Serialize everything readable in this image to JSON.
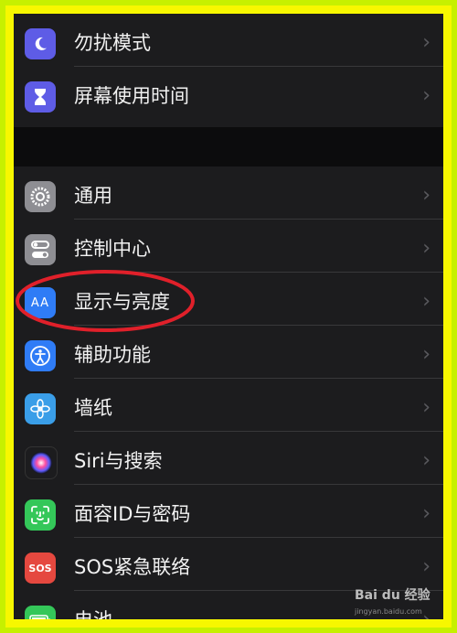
{
  "settings": {
    "top_group": [
      {
        "label": "勿扰模式",
        "icon": "moon-icon",
        "color": "#5e5ce6"
      },
      {
        "label": "屏幕使用时间",
        "icon": "hourglass-icon",
        "color": "#5e5ce6"
      }
    ],
    "main_group": [
      {
        "label": "通用",
        "icon": "gear-icon",
        "color": "#8e8e93"
      },
      {
        "label": "控制中心",
        "icon": "toggles-icon",
        "color": "#8e8e93"
      },
      {
        "label": "显示与亮度",
        "icon": "text-size-icon",
        "icon_text": "AA",
        "color": "#2f7cf6"
      },
      {
        "label": "辅助功能",
        "icon": "accessibility-icon",
        "color": "#2f7cf6"
      },
      {
        "label": "墙纸",
        "icon": "flower-icon",
        "color": "#3a9ee8"
      },
      {
        "label": "Siri与搜索",
        "icon": "siri-icon",
        "color": "#1c1c1e"
      },
      {
        "label": "面容ID与密码",
        "icon": "face-id-icon",
        "color": "#34c759"
      },
      {
        "label": "SOS紧急联络",
        "icon": "sos-icon",
        "icon_text": "SOS",
        "color": "#e5483f"
      },
      {
        "label": "电池",
        "icon": "battery-icon",
        "color": "#34c759"
      }
    ],
    "chevron": "›",
    "highlighted_item": "显示与亮度"
  },
  "watermark": {
    "brand": "Bai du 经验",
    "url": "jingyan.baidu.com"
  },
  "colors": {
    "frame_outer": "#c6f000",
    "frame_inner": "#f7f700",
    "background": "#1c1c1e",
    "highlight_ring": "#e0202a"
  }
}
